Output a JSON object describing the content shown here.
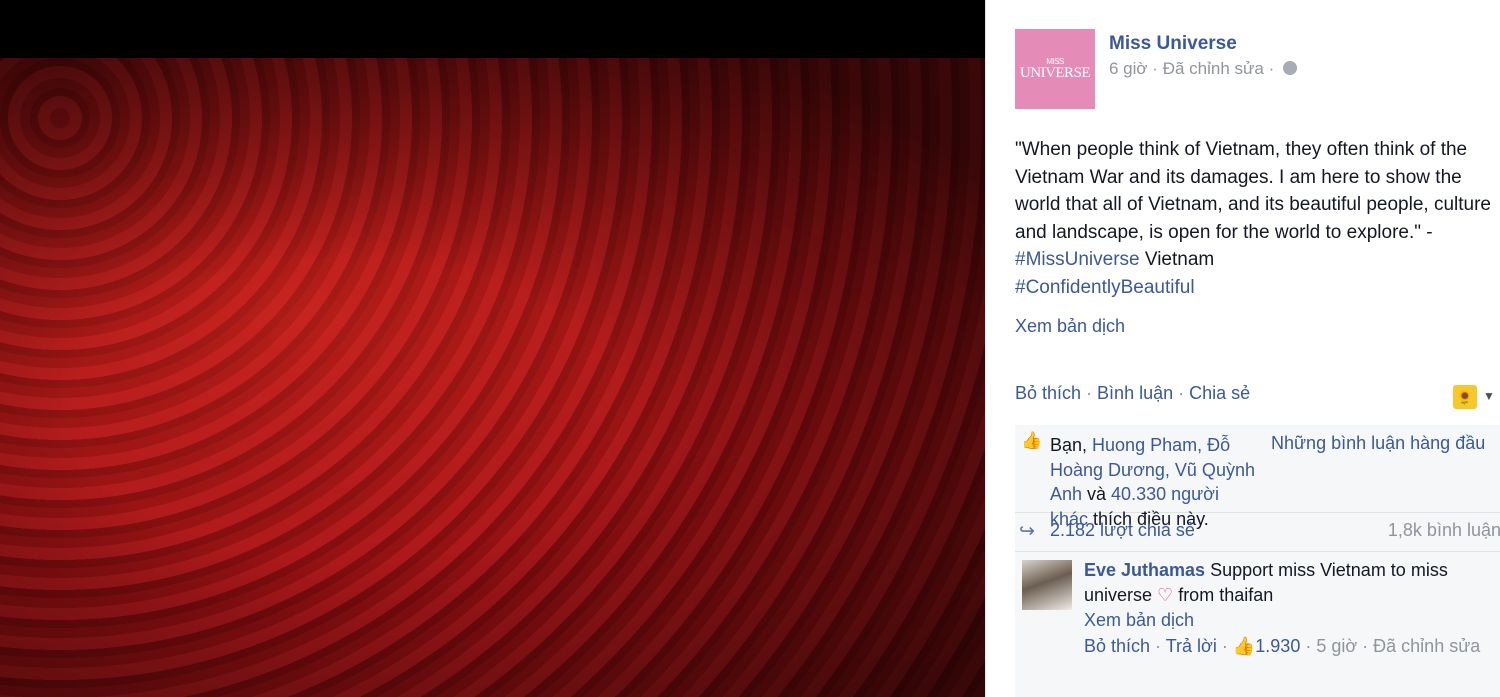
{
  "post": {
    "page_name": "Miss Universe",
    "time": "6 giờ",
    "edited": "Đã chỉnh sửa",
    "dot": "·",
    "avatar_logo_top": "MISS",
    "avatar_logo": "UNIVERSE",
    "text_quote": "\"When people think of Vietnam, they often think of the Vietnam War and its damages. I am here to show the world that all of Vietnam, and its beautiful people, culture and landscape, is open for the world to explore.\" - ",
    "hashtag1": "#MissUniverse",
    "text_after_tag": " Vietnam",
    "hashtag2": "#ConfidentlyBeautiful",
    "see_translation": "Xem bản dịch"
  },
  "actions": {
    "like": "Bỏ thích",
    "comment": "Bình luận",
    "share": "Chia sẻ",
    "sep": " · "
  },
  "likes": {
    "you": "Bạn, ",
    "names": "Huong Pham, Đỗ Hoàng Dương, Vũ Quỳnh Anh",
    "and": " và ",
    "others": "40.330 người khác",
    "suffix": " thích điều này.",
    "top_comments": "Những bình luận hàng đầu"
  },
  "shares": {
    "count": "2.182 lượt chia sẻ",
    "comments": "1,8k bình luận"
  },
  "comment": {
    "author": "Eve Juthamas",
    "text_before": " Support miss Vietnam to miss universe ",
    "text_after": " from thaifan",
    "see_translation": "Xem bản dịch",
    "unlike": "Bỏ thích",
    "reply": "Trả lời",
    "like_count": "1.930",
    "time": "5 giờ",
    "edited": "Đã chỉnh sửa",
    "sep": " · "
  },
  "icons": {
    "globe": "globe-icon",
    "like": "thumbs-up-icon",
    "share": "share-arrow-icon",
    "heart": "heart-icon",
    "emoji": "sunflower-emoji-icon"
  },
  "colors": {
    "link": "#3b5998",
    "meta": "#90949c",
    "avatar_bg": "#e58bb8",
    "photo_bg": "#920f12"
  }
}
